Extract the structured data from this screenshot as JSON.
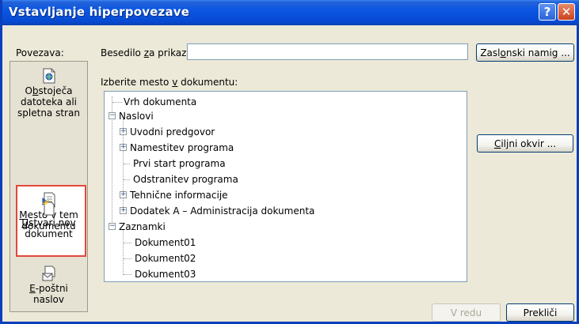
{
  "window": {
    "title": "Vstavljanje hiperpovezave",
    "help_glyph": "?",
    "close_glyph": "✕"
  },
  "link_label": "Povezava:",
  "display_text": {
    "label_a": "Besedilo ",
    "label_key": "z",
    "label_b": "a prikaz:",
    "value": ""
  },
  "screen_tip_button": {
    "a": "Zasl",
    "key": "o",
    "b": "nski namig ..."
  },
  "place_label": {
    "a": "Izberite mesto ",
    "key": "v",
    "b": " dokumentu:"
  },
  "target_frame_button": {
    "a": "",
    "key": "C",
    "b": "iljni okvir ..."
  },
  "sidebar": {
    "items": [
      {
        "line1_a": "O",
        "line1_key": "b",
        "line1_b": "stoječa",
        "line2": "datoteka ali",
        "line3": "spletna stran",
        "icon": "web-page-icon"
      },
      {
        "line1_a": "",
        "line1_key": "M",
        "line1_b": "esto v tem",
        "line2": "dokumentu",
        "icon": "place-in-document-icon",
        "selected": true
      },
      {
        "line1_a": "",
        "line1_key": "U",
        "line1_b": "stvari nov",
        "line2": "dokument",
        "icon": "new-document-icon"
      },
      {
        "line1_a": "",
        "line1_key": "E",
        "line1_b": "-poštni",
        "line2": "naslov",
        "icon": "email-icon"
      }
    ]
  },
  "tree": {
    "top": "Vrh dokumenta",
    "headings_label": "Naslovi",
    "headings": [
      {
        "label": "Uvodni predgovor",
        "expandable": true
      },
      {
        "label": "Namestitev programa",
        "expandable": true
      },
      {
        "label": "Prvi start programa",
        "expandable": false
      },
      {
        "label": "Odstranitev programa",
        "expandable": false
      },
      {
        "label": "Tehnične informacije",
        "expandable": true
      },
      {
        "label": "Dodatek A – Administracija dokumenta",
        "expandable": true
      }
    ],
    "bookmarks_label": "Zaznamki",
    "bookmarks": [
      "Dokument01",
      "Dokument02",
      "Dokument03"
    ]
  },
  "ok_button": "V redu",
  "cancel_button": "Prekliči",
  "colors": {
    "title_bar": "#0a56e3",
    "selection_border": "#e3473a",
    "dialog_bg": "#ece9d8"
  }
}
